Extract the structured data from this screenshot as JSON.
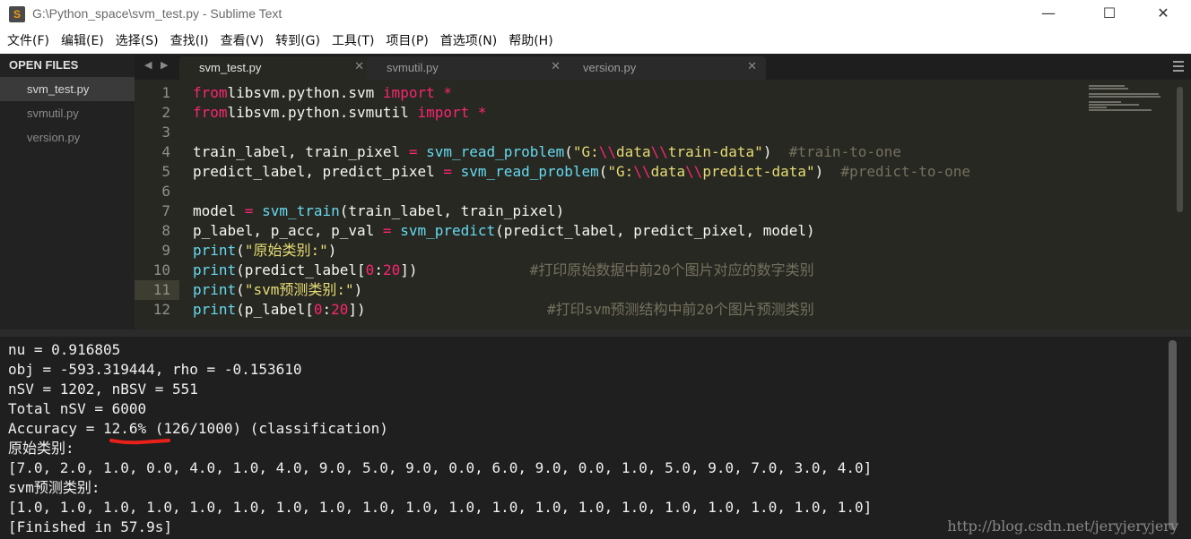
{
  "window": {
    "title": "G:\\Python_space\\svm_test.py - Sublime Text",
    "icon": "S",
    "min": "—",
    "max": "☐",
    "close": "✕"
  },
  "menu": [
    "文件(F)",
    "编辑(E)",
    "选择(S)",
    "查找(I)",
    "查看(V)",
    "转到(G)",
    "工具(T)",
    "项目(P)",
    "首选项(N)",
    "帮助(H)"
  ],
  "sidebar": {
    "header": "OPEN FILES",
    "files": [
      "svm_test.py",
      "svmutil.py",
      "version.py"
    ]
  },
  "tabs": [
    {
      "label": "svm_test.py",
      "close": "✕"
    },
    {
      "label": "svmutil.py",
      "close": "✕"
    },
    {
      "label": "version.py",
      "close": "✕"
    }
  ],
  "editor": {
    "line_numbers": [
      "1",
      "2",
      "3",
      "4",
      "5",
      "6",
      "7",
      "8",
      "9",
      "10",
      "11",
      "12"
    ],
    "current_line": "11",
    "code": [
      [
        [
          "kw",
          "from"
        ],
        [
          "",
          "libsvm.python.svm "
        ],
        [
          "kw",
          "import"
        ],
        [
          "",
          " "
        ],
        [
          "kw",
          "*"
        ]
      ],
      [
        [
          "kw",
          "from"
        ],
        [
          "",
          "libsvm.python.svmutil "
        ],
        [
          "kw",
          "import"
        ],
        [
          "",
          " "
        ],
        [
          "kw",
          "*"
        ]
      ],
      [],
      [
        [
          "",
          "train_label, train_pixel "
        ],
        [
          "kw",
          "="
        ],
        [
          "",
          " "
        ],
        [
          "fn",
          "svm_read_problem"
        ],
        [
          "",
          "("
        ],
        [
          "st",
          "\"G:"
        ],
        [
          "kw",
          "\\\\"
        ],
        [
          "st",
          "data"
        ],
        [
          "kw",
          "\\\\"
        ],
        [
          "st",
          "train-data\""
        ],
        [
          "",
          ")  "
        ],
        [
          "cm",
          "#train-to-one"
        ]
      ],
      [
        [
          "",
          "predict_label, predict_pixel "
        ],
        [
          "kw",
          "="
        ],
        [
          "",
          " "
        ],
        [
          "fn",
          "svm_read_problem"
        ],
        [
          "",
          "("
        ],
        [
          "st",
          "\"G:"
        ],
        [
          "kw",
          "\\\\"
        ],
        [
          "st",
          "data"
        ],
        [
          "kw",
          "\\\\"
        ],
        [
          "st",
          "predict-data\""
        ],
        [
          "",
          ")  "
        ],
        [
          "cm",
          "#predict-to-one"
        ]
      ],
      [],
      [
        [
          "",
          "model "
        ],
        [
          "kw",
          "="
        ],
        [
          "",
          " "
        ],
        [
          "fn",
          "svm_train"
        ],
        [
          "",
          "(train_label, train_pixel)"
        ]
      ],
      [
        [
          "",
          "p_label, p_acc, p_val "
        ],
        [
          "kw",
          "="
        ],
        [
          "",
          " "
        ],
        [
          "fn",
          "svm_predict"
        ],
        [
          "",
          "(predict_label, predict_pixel, model)"
        ]
      ],
      [
        [
          "fn",
          "print"
        ],
        [
          "",
          "("
        ],
        [
          "st",
          "\"原始类别:\""
        ],
        [
          "",
          ")"
        ]
      ],
      [
        [
          "fn",
          "print"
        ],
        [
          "",
          "(predict_label["
        ],
        [
          "kw",
          "0"
        ],
        [
          "",
          ":"
        ],
        [
          "kw",
          "20"
        ],
        [
          "",
          "])             "
        ],
        [
          "cm",
          "#打印原始数据中前20个图片对应的数字类别"
        ]
      ],
      [
        [
          "fn",
          "print"
        ],
        [
          "",
          "("
        ],
        [
          "st",
          "\"svm预测类别:\""
        ],
        [
          "",
          ")"
        ]
      ],
      [
        [
          "fn",
          "print"
        ],
        [
          "",
          "(p_label["
        ],
        [
          "kw",
          "0"
        ],
        [
          "",
          ":"
        ],
        [
          "kw",
          "20"
        ],
        [
          "",
          "])                     "
        ],
        [
          "cm",
          "#打印svm预测结构中前20个图片预测类别"
        ]
      ]
    ]
  },
  "output": {
    "lines": [
      "nu = 0.916805",
      "obj = -593.319444, rho = -0.153610",
      "nSV = 1202, nBSV = 551",
      "Total nSV = 6000",
      "Accuracy = 12.6% (126/1000) (classification)",
      "原始类别:",
      "[7.0, 2.0, 1.0, 0.0, 4.0, 1.0, 4.0, 9.0, 5.0, 9.0, 0.0, 6.0, 9.0, 0.0, 1.0, 5.0, 9.0, 7.0, 3.0, 4.0]",
      "svm预测类别:",
      "[1.0, 1.0, 1.0, 1.0, 1.0, 1.0, 1.0, 1.0, 1.0, 1.0, 1.0, 1.0, 1.0, 1.0, 1.0, 1.0, 1.0, 1.0, 1.0, 1.0]",
      "[Finished in 57.9s]"
    ],
    "watermark": "http://blog.csdn.net/jeryjeryjery",
    "highlight_color": "#e8201a"
  }
}
